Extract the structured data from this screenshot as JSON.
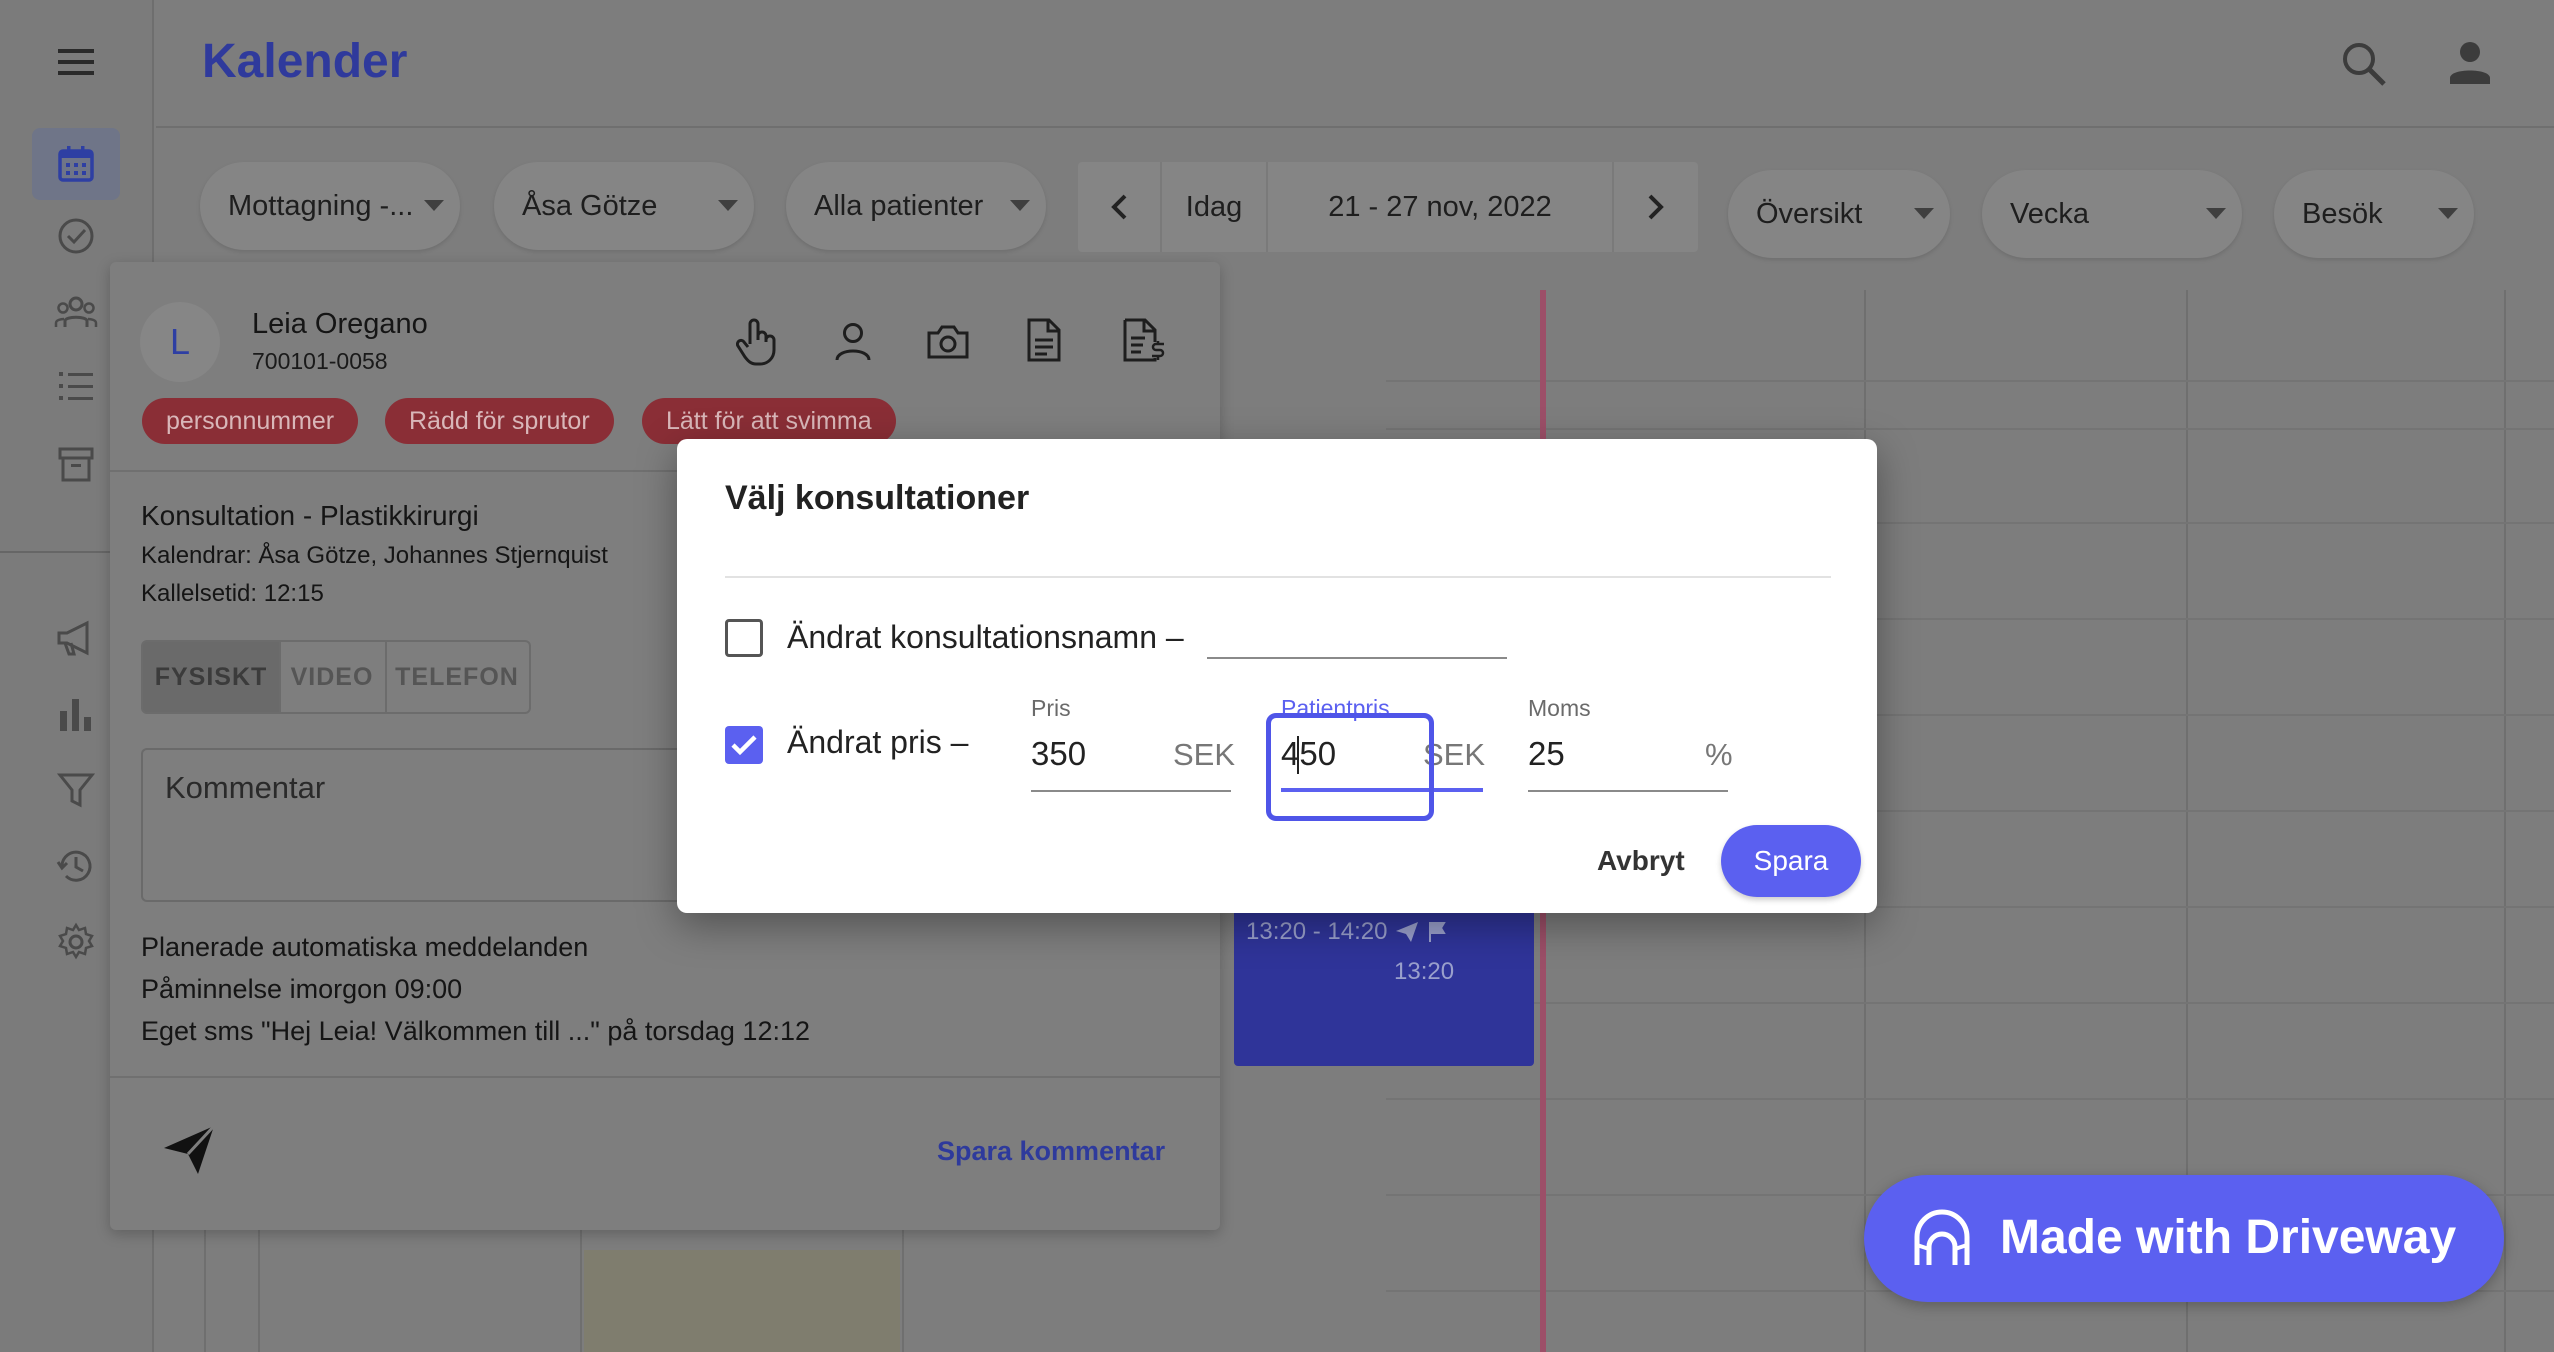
{
  "header": {
    "title": "Kalender",
    "icons": [
      "search-icon",
      "account-icon"
    ]
  },
  "rail": {
    "icons": [
      "menu-icon",
      "calendar-icon",
      "check-circle-icon",
      "groups-icon",
      "list-icon",
      "archive-icon",
      "megaphone-icon",
      "bar-chart-icon",
      "filter-icon",
      "history-icon",
      "settings-icon"
    ]
  },
  "toolbar": {
    "reception": "Mottagning -...",
    "practitioner": "Åsa Götze",
    "patients": "Alla patienter",
    "today": "Idag",
    "date_range": "21 - 27 nov, 2022",
    "view_overview": "Översikt",
    "view_period": "Vecka",
    "view_type": "Besök"
  },
  "patient_card": {
    "avatar_letter": "L",
    "name": "Leia Oregano",
    "personal_number": "700101-0058",
    "tags": [
      "personnummer",
      "Rädd för sprutor",
      "Lätt för att svimma"
    ],
    "action_icons": [
      "hand-pointer-icon",
      "person-icon",
      "camera-icon",
      "document-icon",
      "invoice-icon"
    ],
    "consultation": "Konsultation - Plastikkirurgi",
    "calendars": "Kalendrar: Åsa Götze, Johannes Stjernquist",
    "call_time": "Kallelsetid: 12:15",
    "visit_types": [
      "FYSISKT",
      "VIDEO",
      "TELEFON"
    ],
    "selected_visit_type": "FYSISKT",
    "comment_placeholder": "Kommentar",
    "messages_heading": "Planerade automatiska meddelanden",
    "message_1": "Påminnelse imorgon 09:00",
    "message_2": "Eget sms \"Hej Leia! Välkommen till ...\" på torsdag 12:12",
    "save_comment": "Spara kommentar"
  },
  "calendar_event": {
    "time_range": "13:20 - 14:20",
    "start": "13:20",
    "color": "#2f3499"
  },
  "modal": {
    "title": "Välj konsultationer",
    "name_checkbox_label": "Ändrat konsultationsnamn –",
    "name_checked": false,
    "price_checkbox_label": "Ändrat pris –",
    "price_checked": true,
    "price": {
      "label": "Pris",
      "value": "350",
      "suffix": "SEK"
    },
    "patient_price": {
      "label": "Patientpris",
      "value": "450",
      "suffix": "SEK"
    },
    "vat": {
      "label": "Moms",
      "value": "25",
      "suffix": "%"
    },
    "cancel": "Avbryt",
    "save": "Spara",
    "accent_color": "#5b60f0"
  },
  "badge": {
    "text": "Made with Driveway"
  }
}
